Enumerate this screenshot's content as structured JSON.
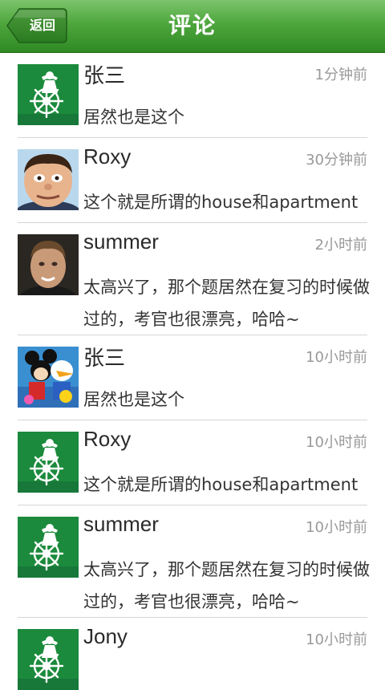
{
  "header": {
    "back_label": "返回",
    "title": "评论"
  },
  "comments": [
    {
      "name": "张三",
      "time": "1分钟前",
      "text": "居然也是这个",
      "avatar": "green-logo"
    },
    {
      "name": "Roxy",
      "time": "30分钟前",
      "text": "这个就是所谓的house和apartment",
      "avatar": "photo-mr-bean"
    },
    {
      "name": "summer",
      "time": "2小时前",
      "text": "太高兴了，那个题居然在复习的时候做过的，考官也很漂亮，哈哈~",
      "avatar": "photo-man"
    },
    {
      "name": "张三",
      "time": "10小时前",
      "text": "居然也是这个",
      "avatar": "cartoon-mickey-donald"
    },
    {
      "name": "Roxy",
      "time": "10小时前",
      "text": "这个就是所谓的house和apartment",
      "avatar": "green-logo"
    },
    {
      "name": "summer",
      "time": "10小时前",
      "text": "太高兴了，那个题居然在复习的时候做过的，考官也很漂亮，哈哈~",
      "avatar": "green-logo"
    },
    {
      "name": "Jony",
      "time": "10小时前",
      "text": "",
      "avatar": "green-logo"
    }
  ]
}
